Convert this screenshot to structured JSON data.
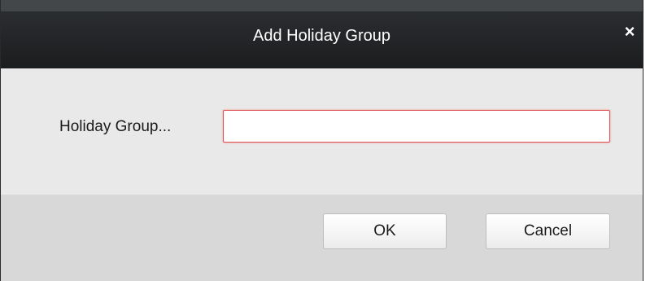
{
  "dialog": {
    "title": "Add Holiday Group",
    "close_glyph": "×",
    "close_icon": "close-icon"
  },
  "form": {
    "label": "Holiday Group...",
    "input_value": "",
    "input_placeholder": "",
    "input_border_color": "#e05252"
  },
  "buttons": {
    "ok_label": "OK",
    "cancel_label": "Cancel"
  },
  "colors": {
    "titlebar": "#1e2022",
    "body": "#e9e9e9",
    "footer": "#d8d8d8"
  }
}
